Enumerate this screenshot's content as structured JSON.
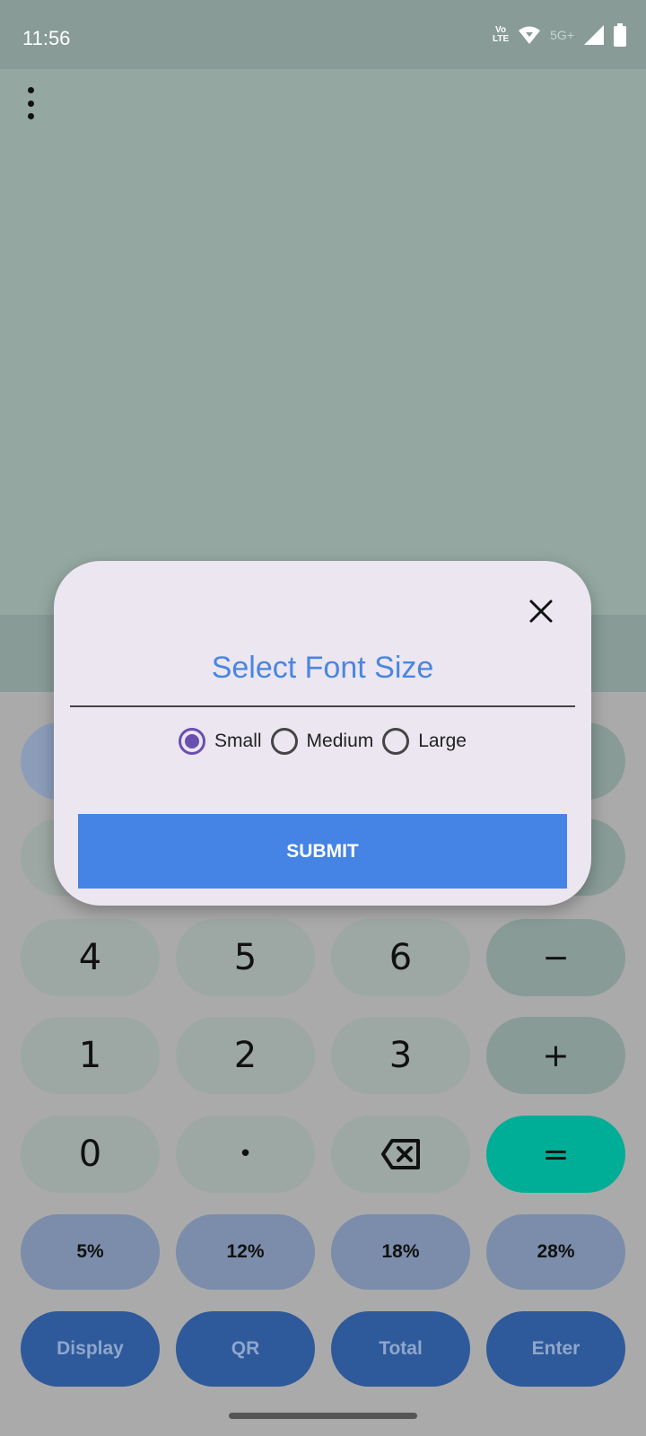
{
  "status_bar": {
    "time": "11:56",
    "volte_top": "Vo",
    "volte_bottom": "LTE",
    "network": "5G+"
  },
  "keypad": {
    "row_numbers_1": [
      "4",
      "5",
      "6"
    ],
    "row_numbers_2": [
      "1",
      "2",
      "3"
    ],
    "row_numbers_3": [
      "0",
      "•"
    ],
    "minus": "−",
    "plus": "+",
    "equals": "=",
    "percent_keys": [
      "5%",
      "12%",
      "18%",
      "28%"
    ],
    "function_keys": [
      "Display",
      "QR",
      "Total",
      "Enter"
    ]
  },
  "dialog": {
    "title": "Select Font Size",
    "options": [
      {
        "label": "Small",
        "checked": true
      },
      {
        "label": "Medium",
        "checked": false
      },
      {
        "label": "Large",
        "checked": false
      }
    ],
    "submit_label": "SUBMIT"
  },
  "colors": {
    "accent_blue": "#4583e4",
    "radio_purple": "#6a4fb3",
    "equals_teal": "#00ad97"
  }
}
